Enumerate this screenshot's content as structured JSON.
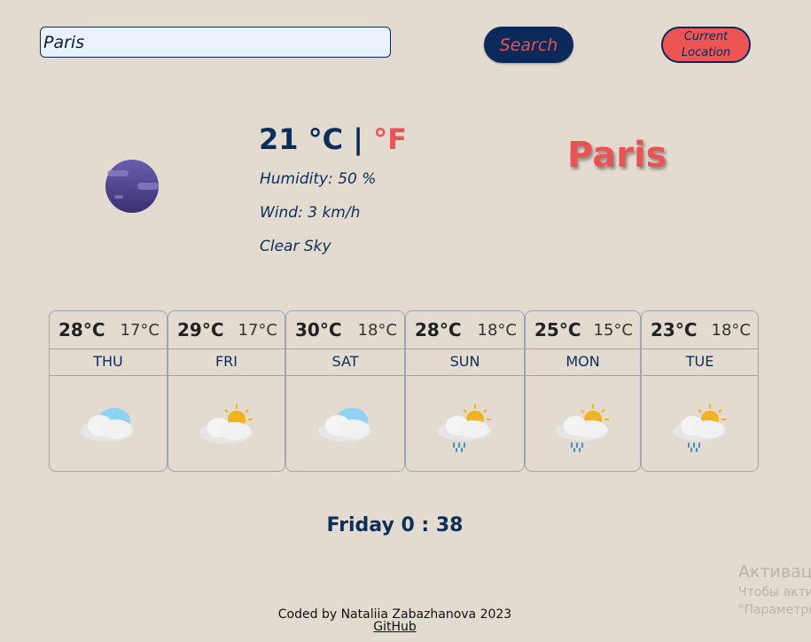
{
  "search": {
    "value": "Paris",
    "button_label": "Search"
  },
  "location_button": {
    "line1": "Current",
    "line2": "Location"
  },
  "current": {
    "temp": "21",
    "unit_c": "°C",
    "separator": "|",
    "unit_f": "°F",
    "humidity": "Humidity: 50 %",
    "wind": "Wind: 3 km/h",
    "description": "Clear Sky",
    "city": "Paris",
    "icon": "moon-icon"
  },
  "forecast": [
    {
      "max": "28°C",
      "min": "17°C",
      "day": "THU",
      "icon": "cloudy-icon"
    },
    {
      "max": "29°C",
      "min": "17°C",
      "day": "FRI",
      "icon": "partly-sunny-icon"
    },
    {
      "max": "30°C",
      "min": "18°C",
      "day": "SAT",
      "icon": "cloudy-icon"
    },
    {
      "max": "28°C",
      "min": "18°C",
      "day": "SUN",
      "icon": "sun-rain-icon"
    },
    {
      "max": "25°C",
      "min": "15°C",
      "day": "MON",
      "icon": "sun-rain-icon"
    },
    {
      "max": "23°C",
      "min": "18°C",
      "day": "TUE",
      "icon": "sun-rain-icon"
    }
  ],
  "clock": "Friday 0 : 38",
  "footer": {
    "credit": "Coded by Nataliia Zabazhanova 2023",
    "link": "GitHub"
  },
  "watermark": {
    "title": "Активаци",
    "line1": "Чтобы акти",
    "line2": "\"Параметры"
  },
  "colors": {
    "background": "#e3dbcf",
    "navy": "#0b2a59",
    "accent": "#e85454"
  }
}
